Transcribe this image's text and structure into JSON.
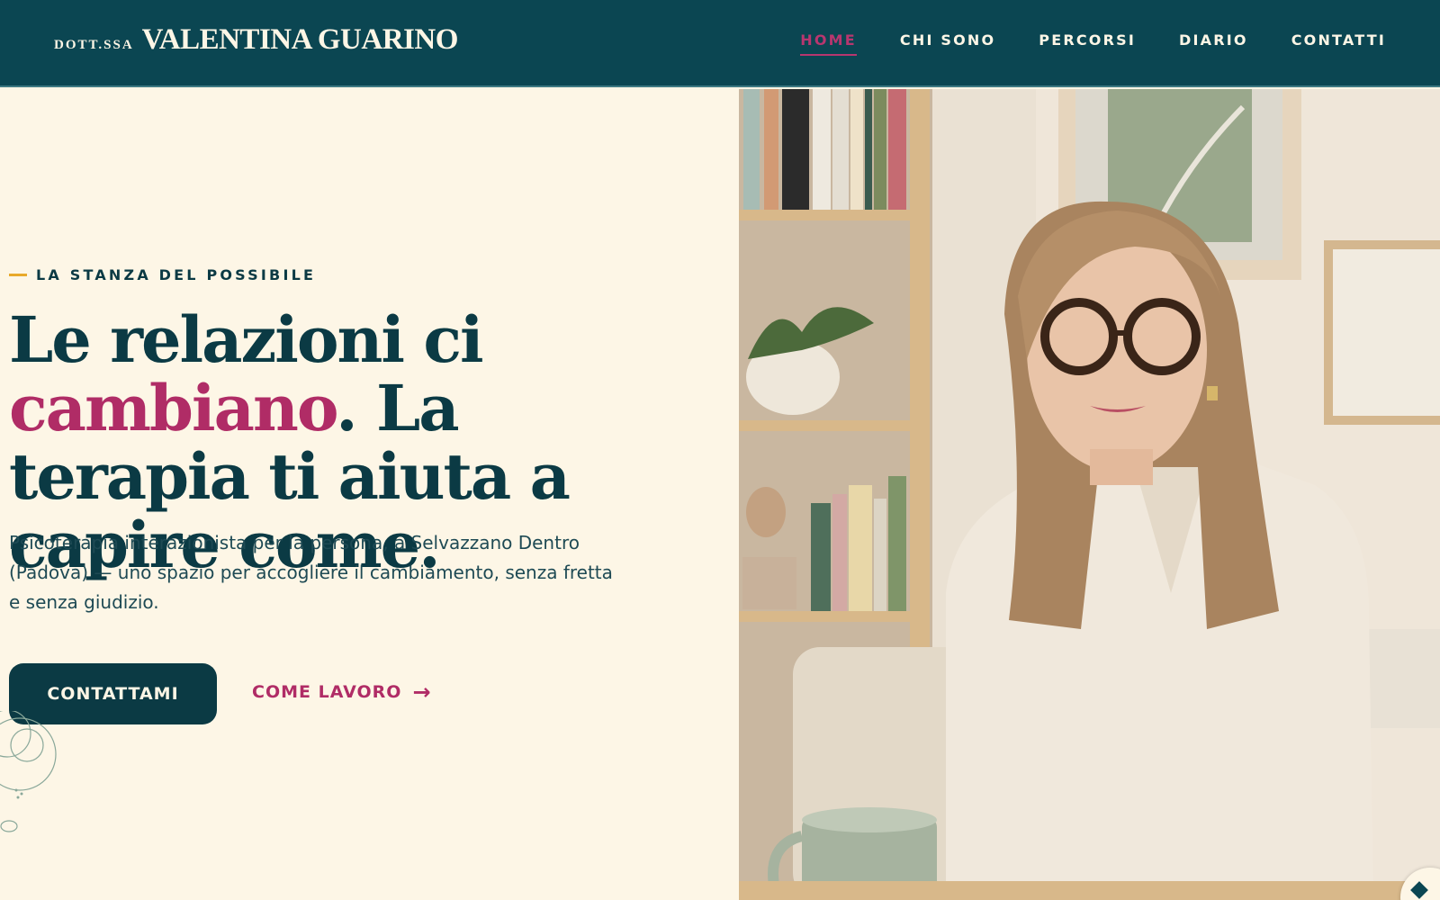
{
  "header": {
    "logo_prefix": "DOTT.SSA",
    "logo_name": "VALENTINA GUARINO",
    "nav": [
      {
        "label": "HOME",
        "active": true
      },
      {
        "label": "CHI SONO",
        "active": false
      },
      {
        "label": "PERCORSI",
        "active": false
      },
      {
        "label": "DIARIO",
        "active": false
      },
      {
        "label": "CONTATTI",
        "active": false
      }
    ]
  },
  "hero": {
    "eyebrow": "LA STANZA DEL POSSIBILE",
    "headline_part1": "Le relazioni ci ",
    "headline_accent": "cambiano",
    "headline_part2": ". La terapia ti aiuta a capire come.",
    "subtitle": "Psicoterapia interazionista per la persona, a Selvazzano Dentro (Padova) — uno spazio per accogliere il cambiamento, senza fretta e senza giudizio.",
    "primary_button": "CONTATTAMI",
    "secondary_link": "COME LAVORO",
    "secondary_arrow": "→"
  },
  "colors": {
    "header_bg": "#0b4652",
    "page_bg": "#fdf6e6",
    "accent": "#b02c66",
    "dark_text": "#0b3a44",
    "eyebrow_dash": "#e8a92a"
  },
  "icons": [
    "arrow-right-icon",
    "floral-decoration-icon",
    "chat-badge-icon"
  ]
}
